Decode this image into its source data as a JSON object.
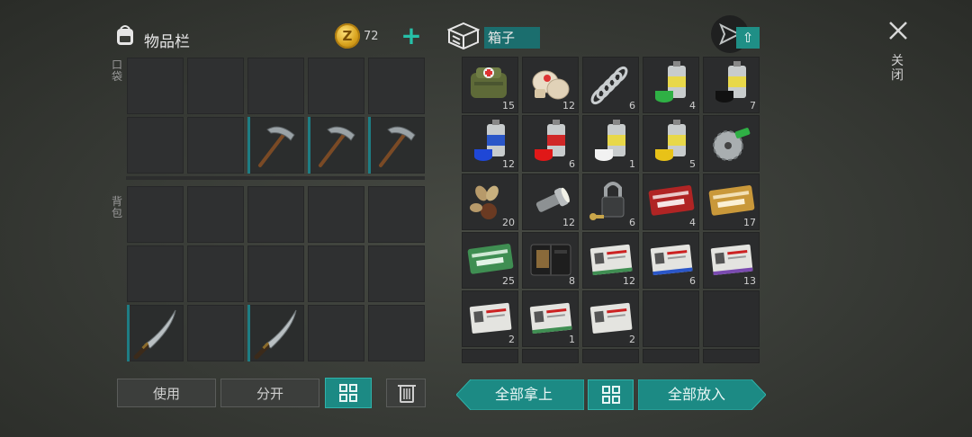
{
  "inventory": {
    "title": "物品栏",
    "coins": "72",
    "coin_symbol": "Z",
    "pocket_label": "口袋",
    "backpack_label": "背包"
  },
  "container": {
    "title": "箱子"
  },
  "close": {
    "label": "关闭"
  },
  "buttons": {
    "use": "使用",
    "split": "分开",
    "take_all": "全部拿上",
    "put_all": "全部放入"
  },
  "box_items": [
    {
      "name": "first-aid-kit",
      "qty": "15"
    },
    {
      "name": "bandages",
      "qty": "12"
    },
    {
      "name": "spring",
      "qty": "6"
    },
    {
      "name": "spray-paint-green",
      "qty": "4"
    },
    {
      "name": "spray-paint-black",
      "qty": "7"
    },
    {
      "name": "spray-paint-blue",
      "qty": "12"
    },
    {
      "name": "spray-paint-red",
      "qty": "6"
    },
    {
      "name": "spray-paint-white",
      "qty": "1"
    },
    {
      "name": "spray-paint-yellow",
      "qty": "5"
    },
    {
      "name": "saw-blade",
      "qty": ""
    },
    {
      "name": "seeds",
      "qty": "20"
    },
    {
      "name": "flashlight",
      "qty": "12"
    },
    {
      "name": "padlock",
      "qty": "6"
    },
    {
      "name": "combat-coupon-red",
      "qty": "4"
    },
    {
      "name": "combat-coupon-gold",
      "qty": "17"
    },
    {
      "name": "ration-coupon",
      "qty": "25"
    },
    {
      "name": "wallet",
      "qty": "8"
    },
    {
      "name": "army-card-a",
      "qty": "12"
    },
    {
      "name": "army-card-b",
      "qty": "6"
    },
    {
      "name": "army-card-c",
      "qty": "13"
    },
    {
      "name": "army-card-d",
      "qty": "2"
    },
    {
      "name": "army-card-f",
      "qty": "1"
    },
    {
      "name": "army-card-r",
      "qty": "2"
    }
  ],
  "colors": {
    "accent": "#1c8a84",
    "accent_light": "#26c0a8",
    "slot_bg": "#2f3031"
  }
}
